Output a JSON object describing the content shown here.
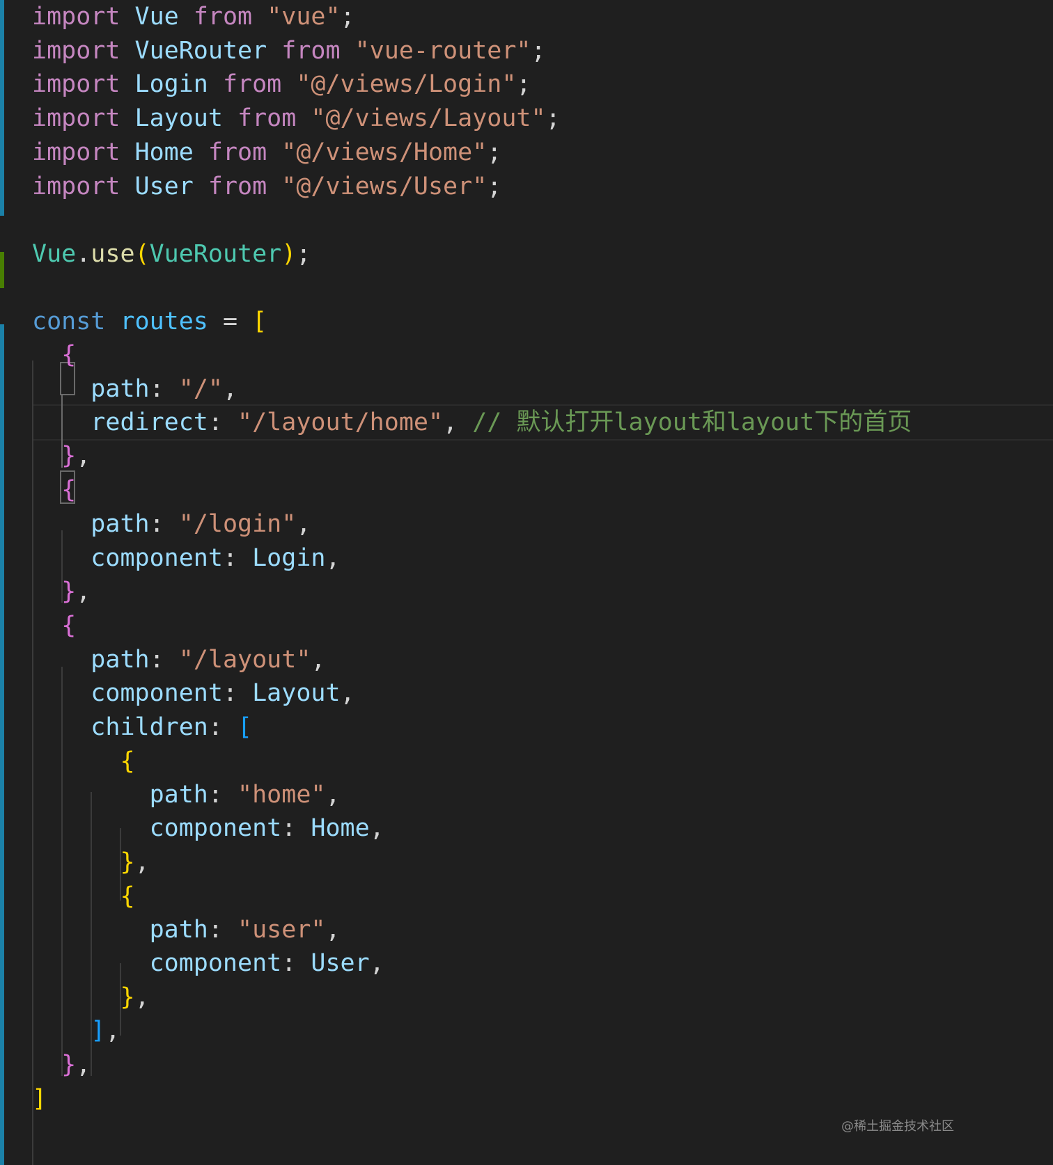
{
  "editor": {
    "theme": {
      "background": "#1f1f1f",
      "keyword": "#c586c0",
      "storage": "#569cd6",
      "identifier": "#9cdcfe",
      "class": "#4ec9b0",
      "function": "#dcdcaa",
      "string": "#ce9178",
      "comment": "#6a9955",
      "punctuation": "#d4d4d4",
      "bracket_level1": "#ffd700",
      "bracket_level2": "#da70d6",
      "bracket_level3": "#179fff",
      "gutter_modified": "#1b81a8",
      "gutter_added": "#487e02"
    },
    "lines": [
      {
        "tokens": [
          {
            "t": "import",
            "c": "keyword"
          },
          {
            "t": " "
          },
          {
            "t": "Vue",
            "c": "identifier"
          },
          {
            "t": " "
          },
          {
            "t": "from",
            "c": "keyword"
          },
          {
            "t": " "
          },
          {
            "t": "\"vue\"",
            "c": "string"
          },
          {
            "t": ";",
            "c": "punctuation"
          }
        ]
      },
      {
        "tokens": [
          {
            "t": "import",
            "c": "keyword"
          },
          {
            "t": " "
          },
          {
            "t": "VueRouter",
            "c": "identifier"
          },
          {
            "t": " "
          },
          {
            "t": "from",
            "c": "keyword"
          },
          {
            "t": " "
          },
          {
            "t": "\"vue-router\"",
            "c": "string"
          },
          {
            "t": ";",
            "c": "punctuation"
          }
        ]
      },
      {
        "tokens": [
          {
            "t": "import",
            "c": "keyword"
          },
          {
            "t": " "
          },
          {
            "t": "Login",
            "c": "identifier"
          },
          {
            "t": " "
          },
          {
            "t": "from",
            "c": "keyword"
          },
          {
            "t": " "
          },
          {
            "t": "\"@/views/Login\"",
            "c": "string"
          },
          {
            "t": ";",
            "c": "punctuation"
          }
        ]
      },
      {
        "tokens": [
          {
            "t": "import",
            "c": "keyword"
          },
          {
            "t": " "
          },
          {
            "t": "Layout",
            "c": "identifier"
          },
          {
            "t": " "
          },
          {
            "t": "from",
            "c": "keyword"
          },
          {
            "t": " "
          },
          {
            "t": "\"@/views/Layout\"",
            "c": "string"
          },
          {
            "t": ";",
            "c": "punctuation"
          }
        ]
      },
      {
        "tokens": [
          {
            "t": "import",
            "c": "keyword"
          },
          {
            "t": " "
          },
          {
            "t": "Home",
            "c": "identifier"
          },
          {
            "t": " "
          },
          {
            "t": "from",
            "c": "keyword"
          },
          {
            "t": " "
          },
          {
            "t": "\"@/views/Home\"",
            "c": "string"
          },
          {
            "t": ";",
            "c": "punctuation"
          }
        ]
      },
      {
        "tokens": [
          {
            "t": "import",
            "c": "keyword"
          },
          {
            "t": " "
          },
          {
            "t": "User",
            "c": "identifier"
          },
          {
            "t": " "
          },
          {
            "t": "from",
            "c": "keyword"
          },
          {
            "t": " "
          },
          {
            "t": "\"@/views/User\"",
            "c": "string"
          },
          {
            "t": ";",
            "c": "punctuation"
          }
        ]
      },
      {
        "tokens": []
      },
      {
        "tokens": [
          {
            "t": "Vue",
            "c": "class"
          },
          {
            "t": ".",
            "c": "punctuation"
          },
          {
            "t": "use",
            "c": "function"
          },
          {
            "t": "(",
            "c": "bracket_level1"
          },
          {
            "t": "VueRouter",
            "c": "class"
          },
          {
            "t": ")",
            "c": "bracket_level1"
          },
          {
            "t": ";",
            "c": "punctuation"
          }
        ]
      },
      {
        "tokens": []
      },
      {
        "tokens": [
          {
            "t": "const",
            "c": "storage"
          },
          {
            "t": " "
          },
          {
            "t": "routes",
            "c": "identifier_const"
          },
          {
            "t": " = ",
            "c": "punctuation"
          },
          {
            "t": "[",
            "c": "bracket_level1"
          }
        ]
      },
      {
        "tokens": [
          {
            "t": "  "
          },
          {
            "t": "{",
            "c": "bracket_level2"
          }
        ]
      },
      {
        "tokens": [
          {
            "t": "    "
          },
          {
            "t": "path",
            "c": "identifier"
          },
          {
            "t": ": ",
            "c": "punctuation"
          },
          {
            "t": "\"/\"",
            "c": "string"
          },
          {
            "t": ",",
            "c": "punctuation"
          }
        ]
      },
      {
        "tokens": [
          {
            "t": "    "
          },
          {
            "t": "redirect",
            "c": "identifier"
          },
          {
            "t": ": ",
            "c": "punctuation"
          },
          {
            "t": "\"/layout/home\"",
            "c": "string"
          },
          {
            "t": ", ",
            "c": "punctuation"
          },
          {
            "t": "// 默认打开layout和layout下的首页",
            "c": "comment"
          }
        ]
      },
      {
        "tokens": [
          {
            "t": "  "
          },
          {
            "t": "}",
            "c": "bracket_level2"
          },
          {
            "t": ",",
            "c": "punctuation"
          }
        ]
      },
      {
        "tokens": [
          {
            "t": "  "
          },
          {
            "t": "{",
            "c": "bracket_level2"
          }
        ]
      },
      {
        "tokens": [
          {
            "t": "    "
          },
          {
            "t": "path",
            "c": "identifier"
          },
          {
            "t": ": ",
            "c": "punctuation"
          },
          {
            "t": "\"/login\"",
            "c": "string"
          },
          {
            "t": ",",
            "c": "punctuation"
          }
        ]
      },
      {
        "tokens": [
          {
            "t": "    "
          },
          {
            "t": "component",
            "c": "identifier"
          },
          {
            "t": ": ",
            "c": "punctuation"
          },
          {
            "t": "Login",
            "c": "identifier"
          },
          {
            "t": ",",
            "c": "punctuation"
          }
        ]
      },
      {
        "tokens": [
          {
            "t": "  "
          },
          {
            "t": "}",
            "c": "bracket_level2"
          },
          {
            "t": ",",
            "c": "punctuation"
          }
        ]
      },
      {
        "tokens": [
          {
            "t": "  "
          },
          {
            "t": "{",
            "c": "bracket_level2"
          }
        ]
      },
      {
        "tokens": [
          {
            "t": "    "
          },
          {
            "t": "path",
            "c": "identifier"
          },
          {
            "t": ": ",
            "c": "punctuation"
          },
          {
            "t": "\"/layout\"",
            "c": "string"
          },
          {
            "t": ",",
            "c": "punctuation"
          }
        ]
      },
      {
        "tokens": [
          {
            "t": "    "
          },
          {
            "t": "component",
            "c": "identifier"
          },
          {
            "t": ": ",
            "c": "punctuation"
          },
          {
            "t": "Layout",
            "c": "identifier"
          },
          {
            "t": ",",
            "c": "punctuation"
          }
        ]
      },
      {
        "tokens": [
          {
            "t": "    "
          },
          {
            "t": "children",
            "c": "identifier"
          },
          {
            "t": ": ",
            "c": "punctuation"
          },
          {
            "t": "[",
            "c": "bracket_level3"
          }
        ]
      },
      {
        "tokens": [
          {
            "t": "      "
          },
          {
            "t": "{",
            "c": "bracket_level1"
          }
        ]
      },
      {
        "tokens": [
          {
            "t": "        "
          },
          {
            "t": "path",
            "c": "identifier"
          },
          {
            "t": ": ",
            "c": "punctuation"
          },
          {
            "t": "\"home\"",
            "c": "string"
          },
          {
            "t": ",",
            "c": "punctuation"
          }
        ]
      },
      {
        "tokens": [
          {
            "t": "        "
          },
          {
            "t": "component",
            "c": "identifier"
          },
          {
            "t": ": ",
            "c": "punctuation"
          },
          {
            "t": "Home",
            "c": "identifier"
          },
          {
            "t": ",",
            "c": "punctuation"
          }
        ]
      },
      {
        "tokens": [
          {
            "t": "      "
          },
          {
            "t": "}",
            "c": "bracket_level1"
          },
          {
            "t": ",",
            "c": "punctuation"
          }
        ]
      },
      {
        "tokens": [
          {
            "t": "      "
          },
          {
            "t": "{",
            "c": "bracket_level1"
          }
        ]
      },
      {
        "tokens": [
          {
            "t": "        "
          },
          {
            "t": "path",
            "c": "identifier"
          },
          {
            "t": ": ",
            "c": "punctuation"
          },
          {
            "t": "\"user\"",
            "c": "string"
          },
          {
            "t": ",",
            "c": "punctuation"
          }
        ]
      },
      {
        "tokens": [
          {
            "t": "        "
          },
          {
            "t": "component",
            "c": "identifier"
          },
          {
            "t": ": ",
            "c": "punctuation"
          },
          {
            "t": "User",
            "c": "identifier"
          },
          {
            "t": ",",
            "c": "punctuation"
          }
        ]
      },
      {
        "tokens": [
          {
            "t": "      "
          },
          {
            "t": "}",
            "c": "bracket_level1"
          },
          {
            "t": ",",
            "c": "punctuation"
          }
        ]
      },
      {
        "tokens": [
          {
            "t": "    "
          },
          {
            "t": "]",
            "c": "bracket_level3"
          },
          {
            "t": ",",
            "c": "punctuation"
          }
        ]
      },
      {
        "tokens": [
          {
            "t": "  "
          },
          {
            "t": "}",
            "c": "bracket_level2"
          },
          {
            "t": ",",
            "c": "punctuation"
          }
        ]
      },
      {
        "tokens": [
          {
            "t": "]",
            "c": "bracket_level1"
          }
        ]
      }
    ]
  },
  "watermark": "@稀土掘金技术社区"
}
